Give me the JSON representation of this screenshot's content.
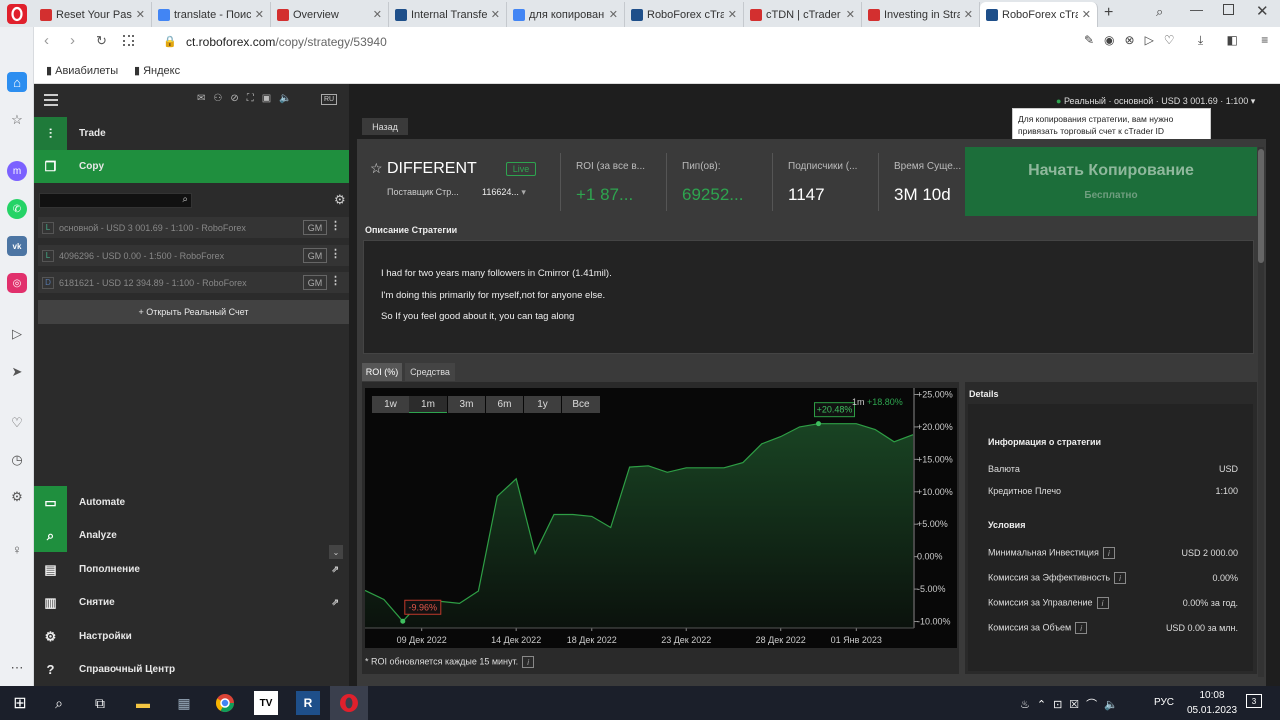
{
  "browser": {
    "tabs": [
      {
        "label": "Reset Your Passw",
        "color": "#d32f2f"
      },
      {
        "label": "translate - Поис",
        "color": "#4285f4"
      },
      {
        "label": "Overview",
        "color": "#d32f2f"
      },
      {
        "label": "Internal Transfer",
        "color": "#1e4f8a"
      },
      {
        "label": "для копирован",
        "color": "#4285f4"
      },
      {
        "label": "RoboForex cTrad",
        "color": "#1e4f8a"
      },
      {
        "label": "cTDN | cTrader C",
        "color": "#d32f2f"
      },
      {
        "label": "Investing in Strat",
        "color": "#d32f2f"
      },
      {
        "label": "RoboForex cTrad",
        "color": "#1e4f8a"
      }
    ],
    "url_domain": "ct.roboforex.com",
    "url_path": "/copy/strategy/53940",
    "bookmarks": [
      "Авиабилеты",
      "Яндекс"
    ]
  },
  "topbar": {
    "account_status": "Реальный · основной · USD 3 001.69 · 1:100",
    "tooltip": "Для копирования стратегии, вам нужно привязать торговый счет к cTrader ID",
    "back": "Назад"
  },
  "sidebar": {
    "lang": "RU",
    "nav": [
      {
        "label": "Trade"
      },
      {
        "label": "Copy"
      }
    ],
    "accounts": [
      {
        "text": "основной - USD 3 001.69 - 1:100 - RoboForex",
        "icon": "L",
        "gm": "GM"
      },
      {
        "text": "4096296 - USD 0.00 - 1:500 - RoboForex",
        "icon": "L",
        "gm": "GM"
      },
      {
        "text": "6181621 - USD 12 394.89 - 1:100 - RoboForex",
        "icon": "D",
        "gm": "GM"
      }
    ],
    "open_account": "+ Открыть Реальный Счет",
    "bottom_nav": [
      {
        "label": "Automate"
      },
      {
        "label": "Analyze"
      },
      {
        "label": "Пополнение"
      },
      {
        "label": "Снятие"
      },
      {
        "label": "Настройки"
      },
      {
        "label": "Справочный Центр"
      }
    ]
  },
  "strategy": {
    "name": "DIFFERENT",
    "live_badge": "Live",
    "provider_label": "Поставщик Стр...",
    "provider_value": "116624...",
    "roi_label": "ROI (за все в...",
    "roi_value": "+1 87...",
    "pips_label": "Пип(ов):",
    "pips_value": "69252...",
    "subs_label": "Подписчики (...",
    "subs_value": "1147",
    "time_label": "Время Суще...",
    "time_value": "3М 10d",
    "cta_title": "Начать Копирование",
    "cta_sub": "Бесплатно"
  },
  "description": {
    "title": "Описание Стратегии",
    "lines": [
      "I had for two years many followers in Cmirror (1.41mil).",
      "I'm doing this primarily for myself,not for anyone else.",
      "So If you feel good about it, you can tag along"
    ]
  },
  "chart_tabs": [
    "ROI (%)",
    "Средства"
  ],
  "timeframes": [
    "1w",
    "1m",
    "3m",
    "6m",
    "1y",
    "Все"
  ],
  "chart_info": {
    "period": "1m",
    "change": "+18.80%",
    "max_label": "+20.48%",
    "min_label": "-9.96%",
    "footnote": "* ROI обновляется каждые 15 минут."
  },
  "chart_data": {
    "type": "area",
    "x": [
      "2022-12-06",
      "2022-12-07",
      "2022-12-08",
      "2022-12-09",
      "2022-12-10",
      "2022-12-11",
      "2022-12-12",
      "2022-12-13",
      "2022-12-14",
      "2022-12-15",
      "2022-12-16",
      "2022-12-17",
      "2022-12-18",
      "2022-12-19",
      "2022-12-20",
      "2022-12-21",
      "2022-12-22",
      "2022-12-23",
      "2022-12-24",
      "2022-12-25",
      "2022-12-26",
      "2022-12-27",
      "2022-12-28",
      "2022-12-29",
      "2022-12-30",
      "2022-12-31",
      "2023-01-01",
      "2023-01-02",
      "2023-01-03",
      "2023-01-04"
    ],
    "values": [
      -5.2,
      -6.6,
      -9.96,
      -6.8,
      -6.9,
      -7.2,
      -5.3,
      9.3,
      12.0,
      0.5,
      6.5,
      6.5,
      6.2,
      4.5,
      13.8,
      14.0,
      13.0,
      13.7,
      13.7,
      13.7,
      14.5,
      17.4,
      18.5,
      20.0,
      20.5,
      20.5,
      20.5,
      19.6,
      17.7,
      18.8
    ],
    "x_ticks": [
      "09 Дек 2022",
      "14 Дек 2022",
      "18 Дек 2022",
      "23 Дек 2022",
      "28 Дек 2022",
      "01 Янв 2023"
    ],
    "y_ticks": [
      "+25.00%",
      "+20.00%",
      "+15.00%",
      "+10.00%",
      "+5.00%",
      "0.00%",
      "-5.00%",
      "-10.00%"
    ],
    "ylim": [
      -11,
      26
    ],
    "colors": {
      "line": "#2e9e45",
      "fill": "#1b4a26"
    }
  },
  "details": {
    "title": "Details",
    "info_title": "Информация о стратегии",
    "info_rows": [
      {
        "label": "Валюта",
        "value": "USD"
      },
      {
        "label": "Кредитное Плечо",
        "value": "1:100"
      }
    ],
    "cond_title": "Условия",
    "cond_rows": [
      {
        "label": "Минимальная Инвестиция",
        "value": "USD 2 000.00"
      },
      {
        "label": "Комиссия за Эффективность",
        "value": "0.00%"
      },
      {
        "label": "Комиссия за Управление",
        "value": "0.00% за год."
      },
      {
        "label": "Комиссия за Объем",
        "value": "USD 0.00 за млн."
      }
    ]
  },
  "taskbar": {
    "lang": "РУС",
    "time": "10:08",
    "date": "05.01.2023",
    "notif": "3"
  }
}
